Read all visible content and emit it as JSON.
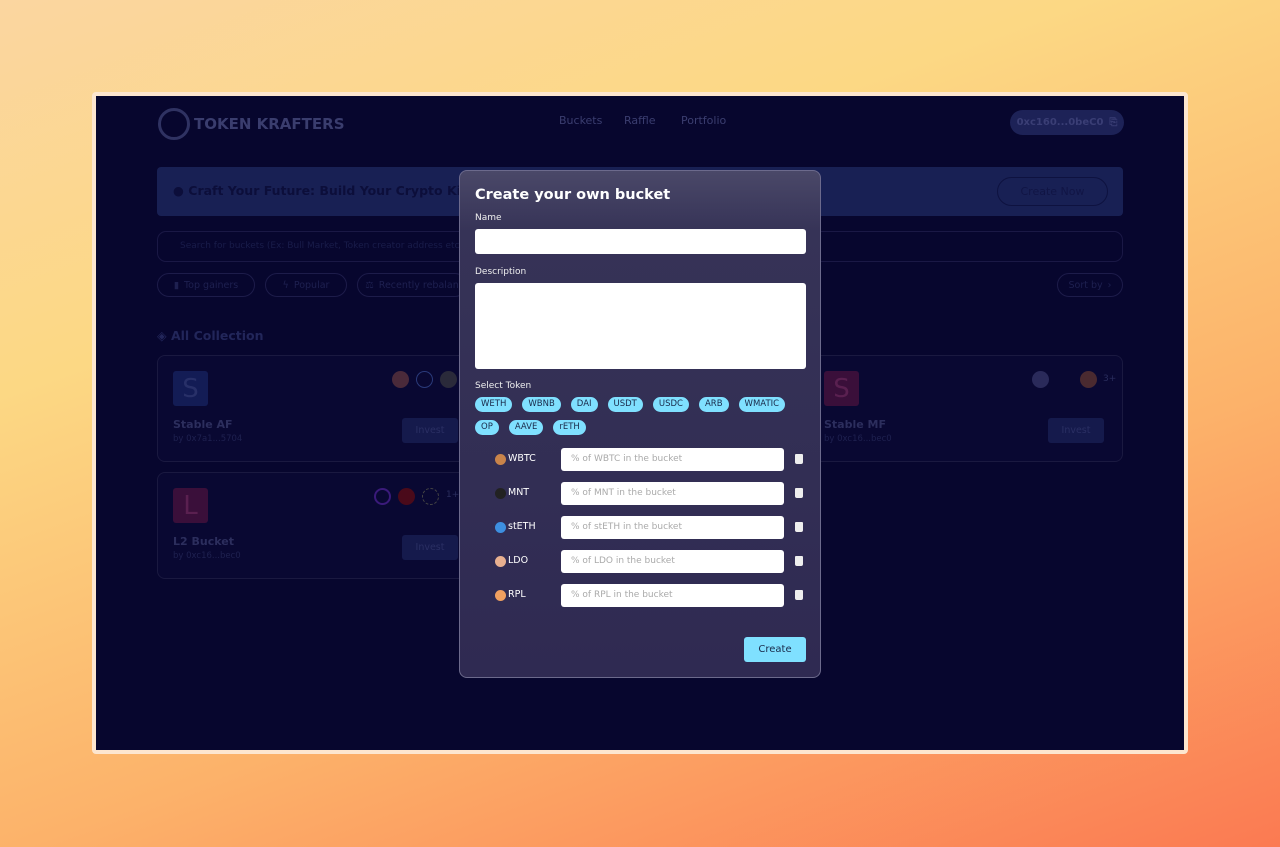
{
  "header": {
    "brand": "TOKEN KRAFTERS",
    "nav": [
      "Buckets",
      "Raffle",
      "Portfolio"
    ],
    "wallet": "0xc160...0beC0"
  },
  "banner": {
    "text": "Craft Your Future: Build Your Crypto Kingdom, C",
    "button": "Create Now"
  },
  "search": {
    "placeholder": "Search for buckets (Ex: Bull Market, Token creator address etc)"
  },
  "filters": [
    "Top gainers",
    "Popular",
    "Recently rebalan"
  ],
  "sort": "Sort by",
  "section_title": "All Collection",
  "cards": [
    {
      "letter": "S",
      "name": "Stable AF",
      "by": "by 0x7a1...5704",
      "invest": "Invest",
      "more": ""
    },
    {
      "letter": "L",
      "name": "L2 Bucket",
      "by": "by 0xc16...bec0",
      "invest": "Invest",
      "more": "1+"
    },
    {
      "letter": "S",
      "name": "Stable MF",
      "by": "by 0xc16...bec0",
      "invest": "Invest",
      "more": "3+"
    }
  ],
  "modal": {
    "title": "Create your own bucket",
    "name_label": "Name",
    "name_value": "",
    "description_label": "Description",
    "description_value": "",
    "select_label": "Select Token",
    "tokens": [
      "WETH",
      "WBNB",
      "DAI",
      "USDT",
      "USDC",
      "ARB",
      "WMATIC",
      "OP",
      "AAVE",
      "rETH"
    ],
    "rows": [
      {
        "token": "WBTC",
        "placeholder": "% of WBTC in the bucket",
        "color": "#c9844a"
      },
      {
        "token": "MNT",
        "placeholder": "% of MNT in the bucket",
        "color": "#222"
      },
      {
        "token": "stETH",
        "placeholder": "% of stETH in the bucket",
        "color": "#3d8fe0"
      },
      {
        "token": "LDO",
        "placeholder": "% of LDO in the bucket",
        "color": "#e8b090"
      },
      {
        "token": "RPL",
        "placeholder": "% of RPL in the bucket",
        "color": "#f0a060"
      }
    ],
    "create": "Create"
  }
}
